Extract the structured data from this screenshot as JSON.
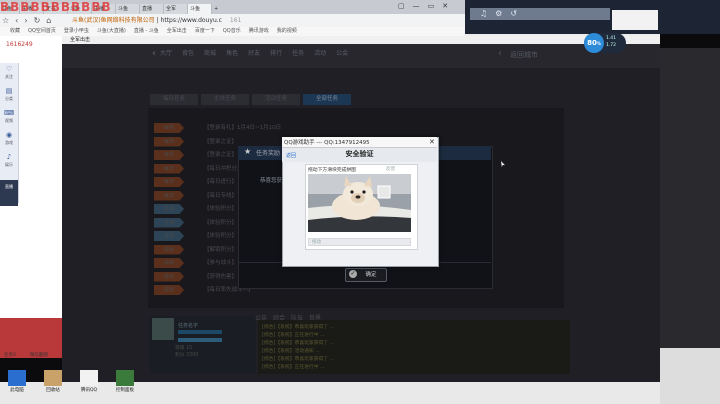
{
  "browser": {
    "watermark": "BBBBBBBBBBB",
    "tabs": [
      {
        "label": "斗鱼",
        "active": false
      },
      {
        "label": "主播",
        "active": false
      },
      {
        "label": "正在",
        "active": false
      },
      {
        "label": "斗鱼",
        "active": false
      },
      {
        "label": "主播",
        "active": false
      },
      {
        "label": "斗鱼",
        "active": false
      },
      {
        "label": "直播",
        "active": false
      },
      {
        "label": "全军",
        "active": false
      },
      {
        "label": "斗鱼",
        "active": true
      }
    ],
    "tab_plus": "+",
    "window_controls": [
      "▢",
      "—",
      "▭",
      "✕"
    ],
    "nav": [
      "☆",
      "‹",
      "›",
      "↻",
      "⌂"
    ],
    "site_name": "斗鱼(武汉)鱼网络科技有限公司",
    "url": "| https://www.douyu.c",
    "url_tail": "161",
    "bookmarks": [
      "收藏",
      "QQ空间首页",
      "登录小甲虫",
      "斗鱼(大直播)",
      "直播 - 斗鱼",
      "全军出击",
      "百度一下",
      "QQ音乐",
      "腾讯游戏",
      "我的视频"
    ]
  },
  "left_page": {
    "number": "1616249",
    "sidebar": [
      {
        "icon": "♡",
        "label": "关注"
      },
      {
        "icon": "▤",
        "label": "分类"
      },
      {
        "icon": "⌨",
        "label": "视频"
      },
      {
        "icon": "◉",
        "label": "游戏"
      },
      {
        "icon": "♪",
        "label": "娱乐"
      }
    ],
    "sidebar_footer": "直播"
  },
  "perf": {
    "value": "80",
    "unit": "%",
    "stats": [
      "1.41",
      "1.72"
    ]
  },
  "game": {
    "window_title": "全军出击",
    "top_tabs": [
      "大厅",
      "背包",
      "商城",
      "角色",
      "好友",
      "排行",
      "任务",
      "活动",
      "公会"
    ],
    "lobby_label": "返回城市",
    "sub_tabs": [
      {
        "label": "每日任务",
        "selected": false
      },
      {
        "label": "主线任务",
        "selected": false
      },
      {
        "label": "活动任务",
        "selected": false
      },
      {
        "label": "全部任务",
        "selected": true
      }
    ],
    "rows": [
      {
        "tag": "每周",
        "desc": "【登录有礼】1月4日~1月10日",
        "color": "#5a2f1c"
      },
      {
        "tag": "每周",
        "desc": "【登录之证】",
        "color": "#5a2f1c"
      },
      {
        "tag": "每周",
        "desc": "【登录之证】",
        "color": "#5a2f1c"
      },
      {
        "tag": "每日",
        "desc": "【每日冲积分】",
        "color": "#5a2f1c"
      },
      {
        "tag": "每日",
        "desc": "【每日进行】",
        "color": "#5a2f1c"
      },
      {
        "tag": "每日",
        "desc": "【每日专线】",
        "color": "#5a2f1c"
      },
      {
        "tag": "主线",
        "desc": "【体验积分】",
        "color": "#2c4455"
      },
      {
        "tag": "主线",
        "desc": "【体验积分】",
        "color": "#2c4455"
      },
      {
        "tag": "主线",
        "desc": "【体验积分】",
        "color": "#2c4455"
      },
      {
        "tag": "成就",
        "desc": "【解锁积分】",
        "color": "#5a2f1c"
      },
      {
        "tag": "成就",
        "desc": "【参与战斗】",
        "color": "#5a2f1c"
      },
      {
        "tag": "成就",
        "desc": "【获得伤害】",
        "color": "#5a2f1c"
      },
      {
        "tag": "成就",
        "desc": "【每日率先战斗人】",
        "color": "#5a2f1c"
      }
    ],
    "task_popup": {
      "title": "任务奖励",
      "body": "恭喜您获得",
      "ok": "确定"
    },
    "chat_caption": [
      "公告",
      "综合",
      "队伍",
      "世界"
    ],
    "chat_lines": [
      "[综合]【系统】恭喜玩家获得了 ...",
      "[综合]【系统】正在进行中 ...",
      "[综合]【系统】恭喜玩家获得了 ...",
      "[综合]【系统】活动通知 ...",
      "[综合]【系统】恭喜玩家获得了 ...",
      "[综合]【系统】正在进行中 ..."
    ],
    "player_name": "任务名字",
    "player_info": [
      "等级 15",
      "积分 2300"
    ]
  },
  "security": {
    "window_title": "QQ游戏助手 --- QQ:1347912495",
    "close": "✕",
    "title": "安全验证",
    "link": "返回",
    "prompt": "拖动下方滑块完成拼图",
    "feedback": "反馈",
    "slider_hint": "拖动"
  },
  "desktop": {
    "thumb_labels": [
      "任务3",
      "微信截图"
    ],
    "icons": [
      "此电脑",
      "回收站",
      "腾讯QQ",
      "控制面板"
    ]
  }
}
